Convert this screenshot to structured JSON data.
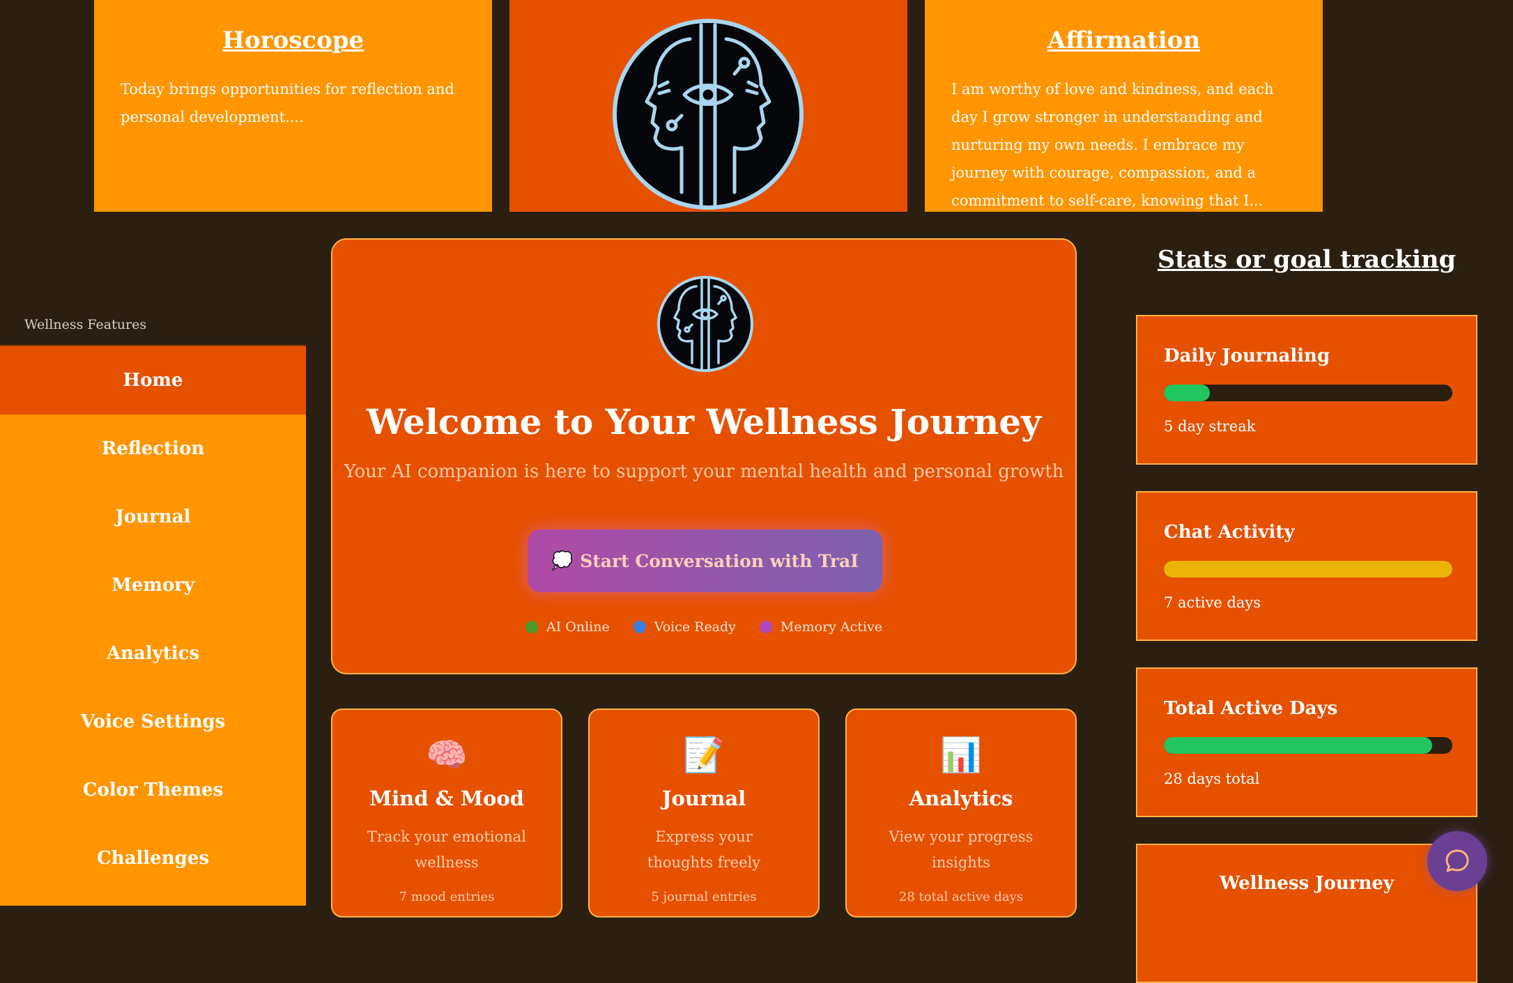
{
  "top_cards": {
    "horoscope": {
      "title": "Horoscope",
      "text": "Today brings opportunities for reflection and personal development...."
    },
    "logo_icon": "dual-face-mind-logo-icon",
    "affirmation": {
      "title": "Affirmation",
      "text": "I am worthy of love and kindness, and each day I grow stronger in understanding and nurturing my own needs. I embrace my journey with courage, compassion, and a commitment to self-care, knowing that I..."
    }
  },
  "sidebar": {
    "label": "Wellness Features",
    "items": [
      {
        "label": "Home",
        "active": true
      },
      {
        "label": "Reflection"
      },
      {
        "label": "Journal"
      },
      {
        "label": "Memory"
      },
      {
        "label": "Analytics"
      },
      {
        "label": "Voice Settings"
      },
      {
        "label": "Color Themes"
      },
      {
        "label": "Challenges"
      }
    ]
  },
  "welcome": {
    "title": "Welcome to Your Wellness Journey",
    "subtitle": "Your AI companion is here to support your mental health and personal growth",
    "cta_icon": "💭",
    "cta_label": "Start Conversation with TraI",
    "statuses": [
      {
        "label": "AI Online",
        "color": "#4c9a2a"
      },
      {
        "label": "Voice Ready",
        "color": "#3b7ddd"
      },
      {
        "label": "Memory Active",
        "color": "#b048c0"
      }
    ]
  },
  "features": [
    {
      "icon": "🧠",
      "title": "Mind & Mood",
      "desc": "Track your emotional wellness",
      "extra": "7 mood entries"
    },
    {
      "icon": "📝",
      "title": "Journal",
      "desc": "Express your thoughts freely",
      "extra": "5 journal entries"
    },
    {
      "icon": "📊",
      "title": "Analytics",
      "desc": "View your progress insights",
      "extra": "28 total active days"
    }
  ],
  "stats": {
    "heading": "Stats or goal tracking",
    "cards": [
      {
        "title": "Daily Journaling",
        "progress": 0.16,
        "color": "#22c55e",
        "text": "5 day streak"
      },
      {
        "title": "Chat Activity",
        "progress": 1.0,
        "color": "#eab308",
        "text": "7 active days"
      },
      {
        "title": "Total Active Days",
        "progress": 0.93,
        "color": "#22c55e",
        "text": "28 days total"
      }
    ],
    "last_card_title": "Wellness Journey"
  },
  "colors": {
    "background": "#2b1f12",
    "accent_orange": "#ff9500",
    "accent_deep": "#e65100"
  },
  "chat_fab_icon": "chat-bubble-icon"
}
